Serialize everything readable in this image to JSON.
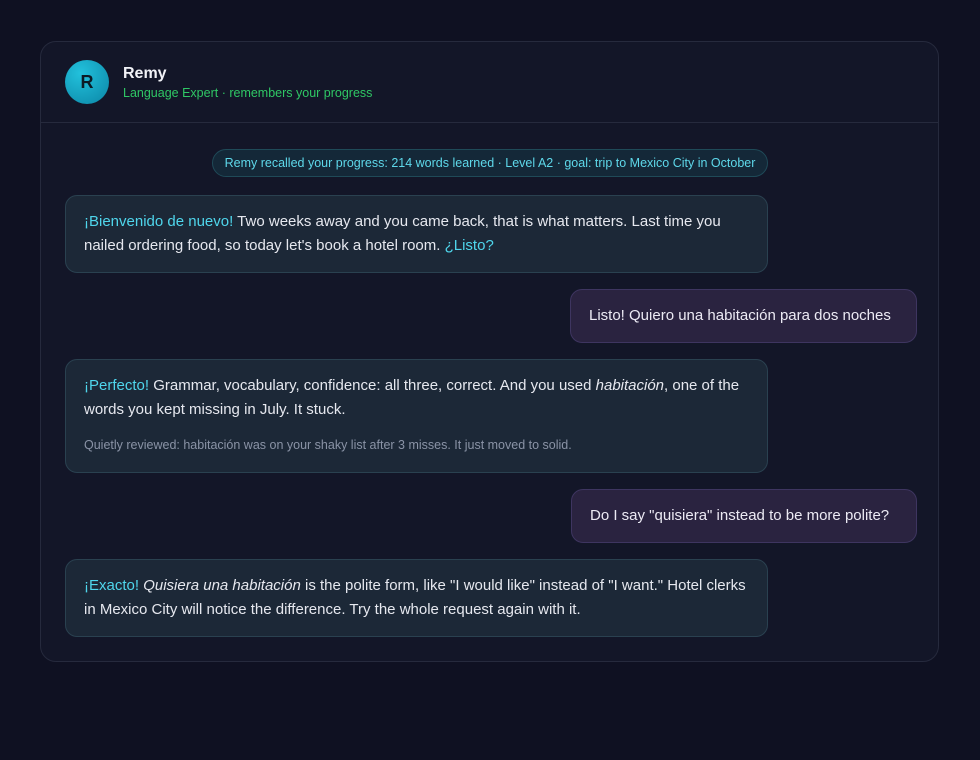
{
  "header": {
    "avatar_letter": "R",
    "name": "Remy",
    "subtitle": "Language Expert · remembers your progress"
  },
  "memory_pill": "Remy recalled your progress: 214 words learned · Level A2 · goal: trip to Mexico City in October",
  "messages": [
    {
      "lead": "¡Bienvenido de nuevo!",
      "text": " Two weeks away and you came back, that is what matters. Last time you nailed ordering food, so today let's book a hotel room. ",
      "trail": "¿Listo?"
    },
    {
      "text": "Listo! Quiero una habitación para dos noches"
    },
    {
      "lead": "¡Perfecto!",
      "text1": " Grammar, vocabulary, confidence: all three, correct. And you used ",
      "italic": "habitación",
      "text2": ", one of the words you kept missing in July. It stuck.",
      "note": "Quietly reviewed: habitación was on your shaky list after 3 misses. It just moved to solid."
    },
    {
      "text": "Do I say \"quisiera\" instead to be more polite?"
    },
    {
      "lead": "¡Exacto!",
      "italic": "Quisiera una habitación",
      "text": " is the polite form, like \"I would like\" instead of \"I want.\" Hotel clerks in Mexico City will notice the difference. Try the whole request again with it."
    }
  ]
}
